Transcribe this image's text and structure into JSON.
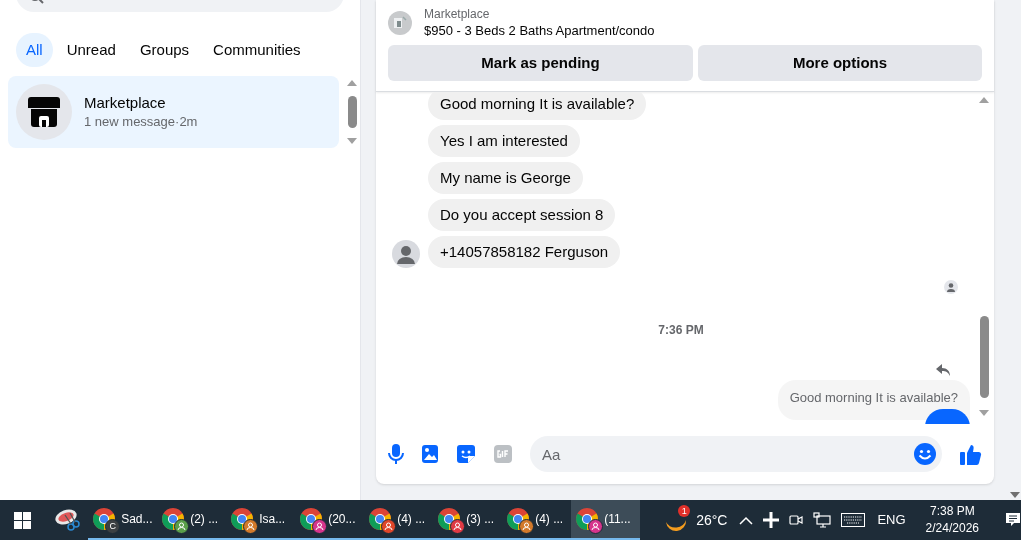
{
  "filter_tabs": [
    {
      "label": "All",
      "selected": true
    },
    {
      "label": "Unread",
      "selected": false
    },
    {
      "label": "Groups",
      "selected": false
    },
    {
      "label": "Communities",
      "selected": false
    }
  ],
  "conversations": [
    {
      "name": "Marketplace",
      "preview": "1 new message·2m",
      "selected": true
    }
  ],
  "listing": {
    "category": "Marketplace",
    "title": "$950 - 3 Beds 2 Baths Apartment/condo"
  },
  "actions": [
    "Mark as pending",
    "More options"
  ],
  "messages": [
    {
      "kind": "incoming",
      "text": "Good morning It is available?",
      "avatar": false
    },
    {
      "kind": "incoming",
      "text": "Yes I am interested",
      "avatar": false
    },
    {
      "kind": "incoming",
      "text": "My name is George",
      "avatar": false
    },
    {
      "kind": "incoming",
      "text": "Do you accept session 8",
      "avatar": false
    },
    {
      "kind": "incoming",
      "text": "+14057858182 Ferguson",
      "avatar": true
    },
    {
      "kind": "seen"
    },
    {
      "kind": "timestamp",
      "text": "7:36 PM"
    },
    {
      "kind": "reply_quote",
      "text": "Good morning It is available?"
    },
    {
      "kind": "outgoing"
    }
  ],
  "composer": {
    "placeholder": "Aa"
  },
  "taskbar": {
    "apps": [
      {
        "label": "Sad...",
        "badge": "C",
        "color": "#3c4043",
        "selected": false
      },
      {
        "label": "(2) ...",
        "color": "#5a9e4a",
        "selected": false
      },
      {
        "label": "Isa...",
        "color": "#d2792a",
        "selected": false
      },
      {
        "label": "(20...",
        "color": "#d6348c",
        "selected": false
      },
      {
        "label": "(4) ...",
        "color": "#e0462a",
        "selected": false
      },
      {
        "label": "(3) ...",
        "color": "#e03a44",
        "selected": false
      },
      {
        "label": "(4) ...",
        "color": "#d2792a",
        "selected": false
      },
      {
        "label": "(11...",
        "color": "#d6348c",
        "selected": true
      }
    ],
    "weather": {
      "badge": "1",
      "temperature": "26°C"
    },
    "language": "ENG",
    "time": "7:38 PM",
    "date": "2/24/2026"
  }
}
